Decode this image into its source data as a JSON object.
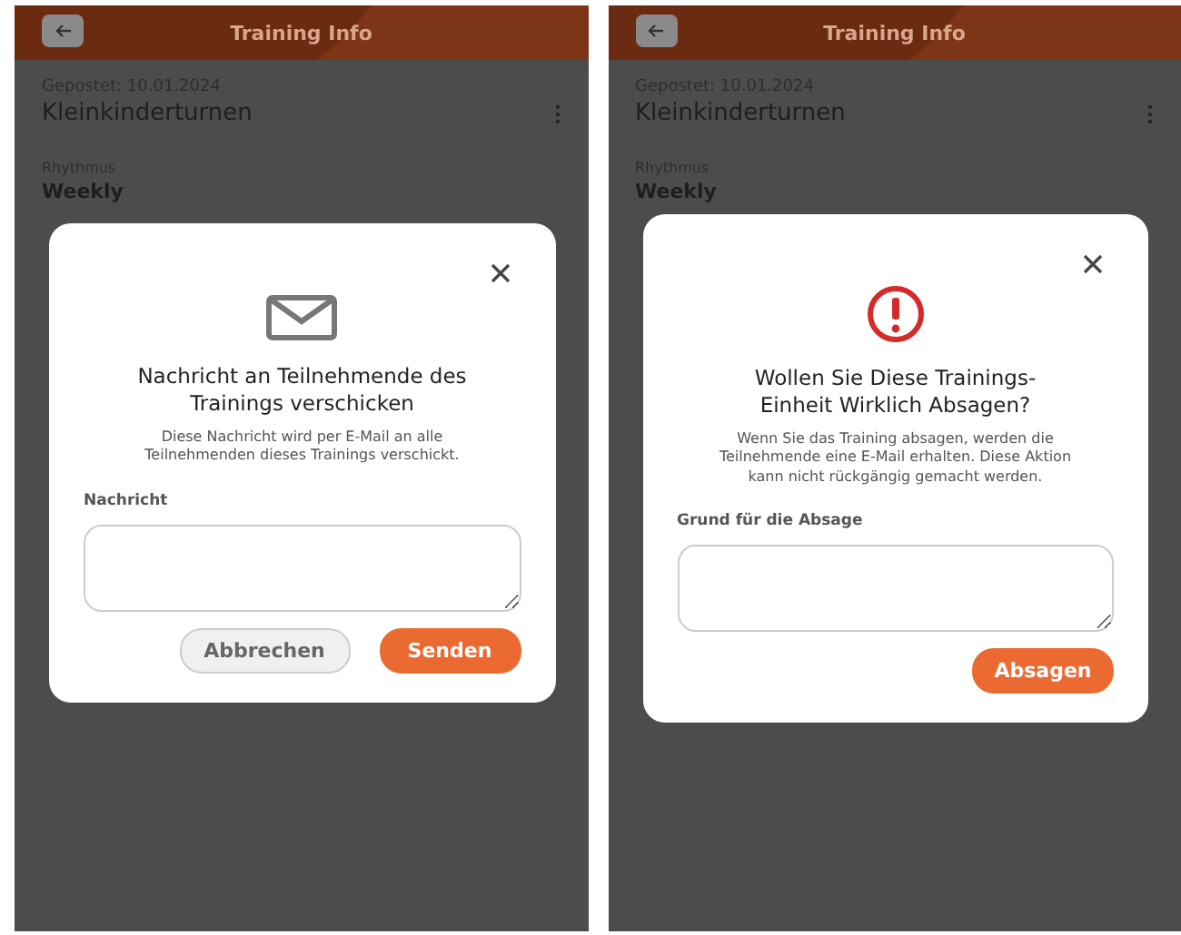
{
  "screens": [
    {
      "header": {
        "title": "Training Info"
      },
      "posted": "Gepostet: 10.01.2024",
      "training_name": "Kleinkinderturnen",
      "rhythm_label": "Rhythmus",
      "rhythm_value": "Weekly",
      "dialog": {
        "kind": "message",
        "title": "Nachricht an Teilnehmende des Trainings verschicken",
        "description": "Diese Nachricht wird per E-Mail an alle Teilnehmenden dieses Trainings verschickt.",
        "field_label": "Nachricht",
        "buttons": [
          {
            "label": "Abbrechen",
            "kind": "secondary"
          },
          {
            "label": "Senden",
            "kind": "primary"
          }
        ]
      }
    },
    {
      "header": {
        "title": "Training Info"
      },
      "posted": "Gepostet: 10.01.2024",
      "training_name": "Kleinkinderturnen",
      "rhythm_label": "Rhythmus",
      "rhythm_value": "Weekly",
      "dialog": {
        "kind": "warning",
        "title": "Wollen Sie Diese Trainings-Einheit Wirklich Absagen?",
        "description": "Wenn Sie das Training absagen, werden die Teilnehmende eine E-Mail erhalten. Diese Aktion kann nicht rückgängig gemacht werden.",
        "field_label": "Grund für die Absage",
        "buttons": [
          {
            "label": "Absagen",
            "kind": "primary"
          }
        ]
      }
    }
  ]
}
